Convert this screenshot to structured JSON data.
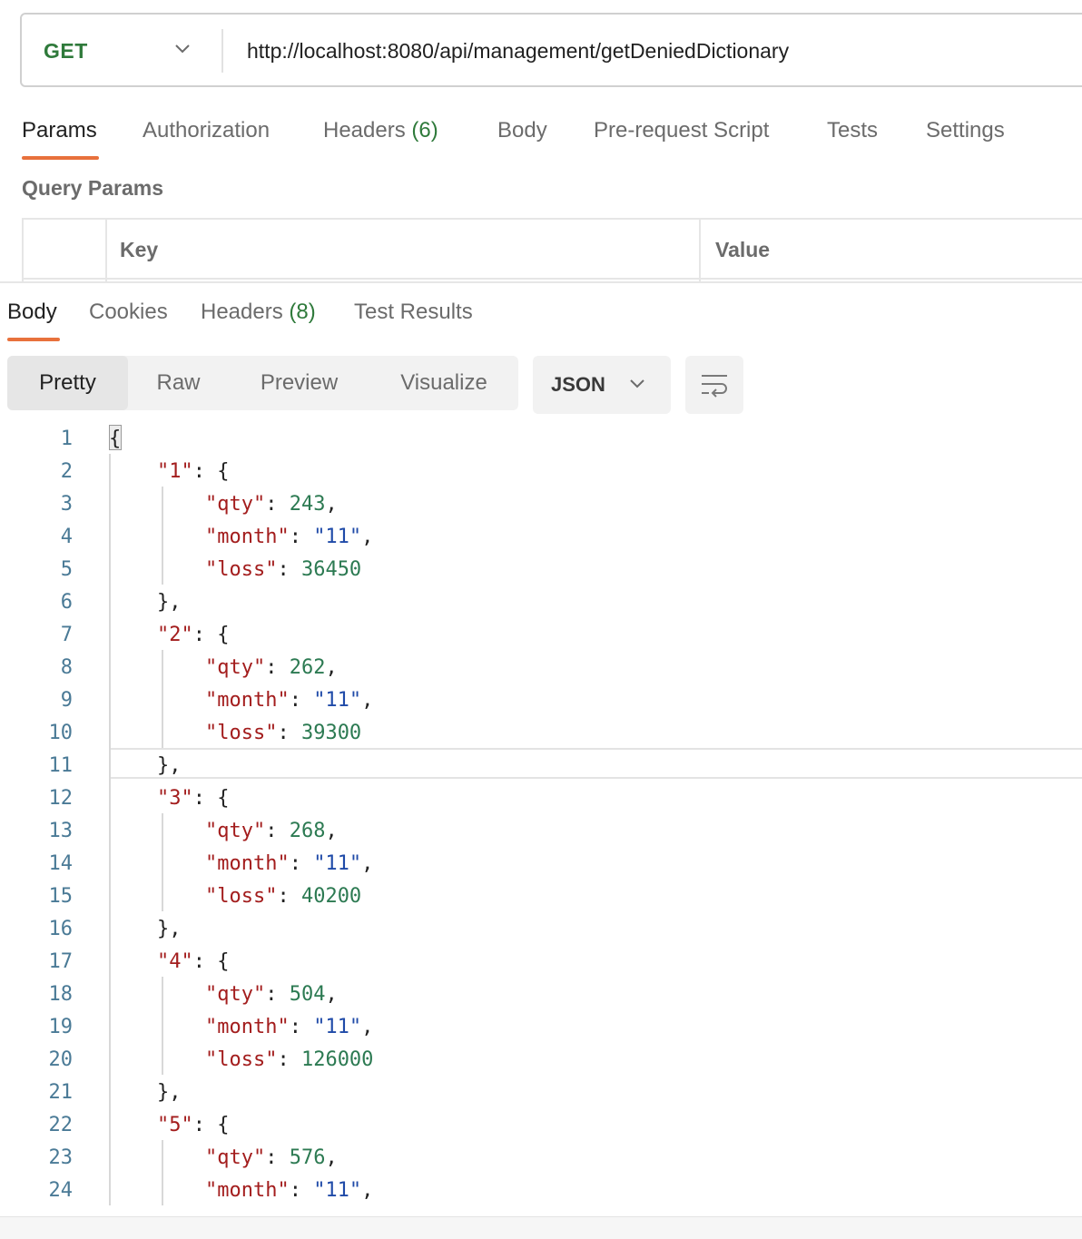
{
  "request": {
    "method": "GET",
    "url": "http://localhost:8080/api/management/getDeniedDictionary"
  },
  "request_tabs": [
    {
      "label": "Params",
      "count": ""
    },
    {
      "label": "Authorization",
      "count": ""
    },
    {
      "label": "Headers",
      "count": "(6)"
    },
    {
      "label": "Body",
      "count": ""
    },
    {
      "label": "Pre-request Script",
      "count": ""
    },
    {
      "label": "Tests",
      "count": ""
    },
    {
      "label": "Settings",
      "count": ""
    }
  ],
  "query_params": {
    "title": "Query Params",
    "columns": [
      "Key",
      "Value"
    ]
  },
  "response_tabs": [
    {
      "label": "Body",
      "count": ""
    },
    {
      "label": "Cookies",
      "count": ""
    },
    {
      "label": "Headers",
      "count": "(8)"
    },
    {
      "label": "Test Results",
      "count": ""
    }
  ],
  "view_modes": [
    "Pretty",
    "Raw",
    "Preview",
    "Visualize"
  ],
  "format": "JSON",
  "code_lines": [
    [
      [
        "p",
        "{"
      ]
    ],
    [
      [
        "p",
        "    "
      ],
      [
        "k",
        "\"1\""
      ],
      [
        "p",
        ": {"
      ]
    ],
    [
      [
        "p",
        "        "
      ],
      [
        "k",
        "\"qty\""
      ],
      [
        "p",
        ": "
      ],
      [
        "n",
        "243"
      ],
      [
        "p",
        ","
      ]
    ],
    [
      [
        "p",
        "        "
      ],
      [
        "k",
        "\"month\""
      ],
      [
        "p",
        ": "
      ],
      [
        "s",
        "\"11\""
      ],
      [
        "p",
        ","
      ]
    ],
    [
      [
        "p",
        "        "
      ],
      [
        "k",
        "\"loss\""
      ],
      [
        "p",
        ": "
      ],
      [
        "n",
        "36450"
      ]
    ],
    [
      [
        "p",
        "    },"
      ]
    ],
    [
      [
        "p",
        "    "
      ],
      [
        "k",
        "\"2\""
      ],
      [
        "p",
        ": {"
      ]
    ],
    [
      [
        "p",
        "        "
      ],
      [
        "k",
        "\"qty\""
      ],
      [
        "p",
        ": "
      ],
      [
        "n",
        "262"
      ],
      [
        "p",
        ","
      ]
    ],
    [
      [
        "p",
        "        "
      ],
      [
        "k",
        "\"month\""
      ],
      [
        "p",
        ": "
      ],
      [
        "s",
        "\"11\""
      ],
      [
        "p",
        ","
      ]
    ],
    [
      [
        "p",
        "        "
      ],
      [
        "k",
        "\"loss\""
      ],
      [
        "p",
        ": "
      ],
      [
        "n",
        "39300"
      ]
    ],
    [
      [
        "p",
        "    },"
      ]
    ],
    [
      [
        "p",
        "    "
      ],
      [
        "k",
        "\"3\""
      ],
      [
        "p",
        ": {"
      ]
    ],
    [
      [
        "p",
        "        "
      ],
      [
        "k",
        "\"qty\""
      ],
      [
        "p",
        ": "
      ],
      [
        "n",
        "268"
      ],
      [
        "p",
        ","
      ]
    ],
    [
      [
        "p",
        "        "
      ],
      [
        "k",
        "\"month\""
      ],
      [
        "p",
        ": "
      ],
      [
        "s",
        "\"11\""
      ],
      [
        "p",
        ","
      ]
    ],
    [
      [
        "p",
        "        "
      ],
      [
        "k",
        "\"loss\""
      ],
      [
        "p",
        ": "
      ],
      [
        "n",
        "40200"
      ]
    ],
    [
      [
        "p",
        "    },"
      ]
    ],
    [
      [
        "p",
        "    "
      ],
      [
        "k",
        "\"4\""
      ],
      [
        "p",
        ": {"
      ]
    ],
    [
      [
        "p",
        "        "
      ],
      [
        "k",
        "\"qty\""
      ],
      [
        "p",
        ": "
      ],
      [
        "n",
        "504"
      ],
      [
        "p",
        ","
      ]
    ],
    [
      [
        "p",
        "        "
      ],
      [
        "k",
        "\"month\""
      ],
      [
        "p",
        ": "
      ],
      [
        "s",
        "\"11\""
      ],
      [
        "p",
        ","
      ]
    ],
    [
      [
        "p",
        "        "
      ],
      [
        "k",
        "\"loss\""
      ],
      [
        "p",
        ": "
      ],
      [
        "n",
        "126000"
      ]
    ],
    [
      [
        "p",
        "    },"
      ]
    ],
    [
      [
        "p",
        "    "
      ],
      [
        "k",
        "\"5\""
      ],
      [
        "p",
        ": {"
      ]
    ],
    [
      [
        "p",
        "        "
      ],
      [
        "k",
        "\"qty\""
      ],
      [
        "p",
        ": "
      ],
      [
        "n",
        "576"
      ],
      [
        "p",
        ","
      ]
    ],
    [
      [
        "p",
        "        "
      ],
      [
        "k",
        "\"month\""
      ],
      [
        "p",
        ": "
      ],
      [
        "s",
        "\"11\""
      ],
      [
        "p",
        ","
      ]
    ]
  ],
  "colors": {
    "method": "#2f7a3b",
    "active_tab_underline": "#e8713c",
    "json_key": "#a31d1d",
    "json_number": "#2c7a52",
    "json_string": "#1f4aa8",
    "line_number": "#4a7a96"
  },
  "icons": {
    "method_dropdown": "chevron-down-icon",
    "format_dropdown": "chevron-down-icon",
    "wrap_lines": "wrap-lines-icon"
  }
}
